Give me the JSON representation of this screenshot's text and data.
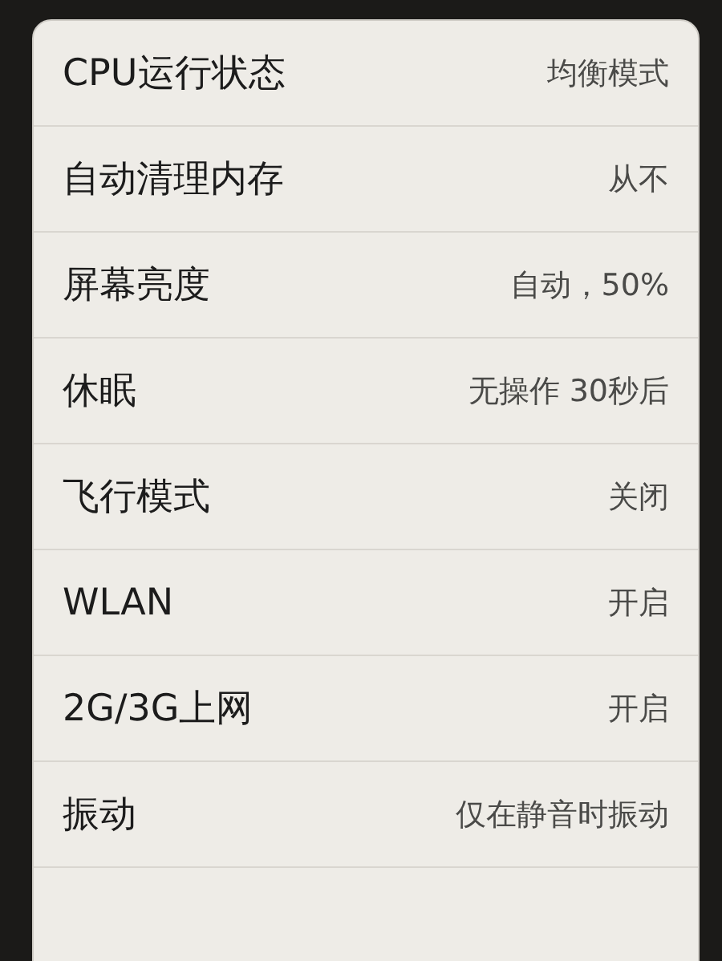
{
  "settings": [
    {
      "label": "CPU运行状态",
      "value": "均衡模式"
    },
    {
      "label": "自动清理内存",
      "value": "从不"
    },
    {
      "label": "屏幕亮度",
      "value": "自动，50%"
    },
    {
      "label": "休眠",
      "value": "无操作 30秒后"
    },
    {
      "label": "飞行模式",
      "value": "关闭"
    },
    {
      "label": "WLAN",
      "value": "开启"
    },
    {
      "label": "2G/3G上网",
      "value": "开启"
    },
    {
      "label": "振动",
      "value": "仅在静音时振动"
    }
  ]
}
